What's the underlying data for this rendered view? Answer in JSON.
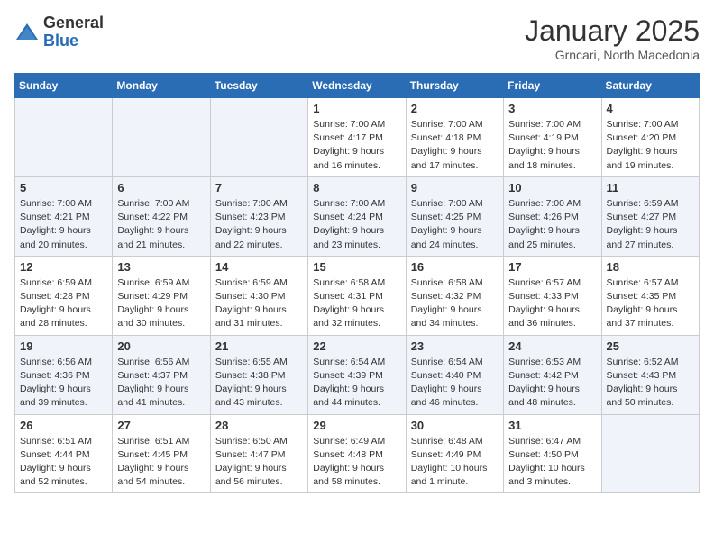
{
  "header": {
    "logo_general": "General",
    "logo_blue": "Blue",
    "month_title": "January 2025",
    "location": "Grncari, North Macedonia"
  },
  "weekdays": [
    "Sunday",
    "Monday",
    "Tuesday",
    "Wednesday",
    "Thursday",
    "Friday",
    "Saturday"
  ],
  "weeks": [
    [
      {
        "day": "",
        "empty": true
      },
      {
        "day": "",
        "empty": true
      },
      {
        "day": "",
        "empty": true
      },
      {
        "day": "1",
        "sunrise": "7:00 AM",
        "sunset": "4:17 PM",
        "daylight": "9 hours and 16 minutes."
      },
      {
        "day": "2",
        "sunrise": "7:00 AM",
        "sunset": "4:18 PM",
        "daylight": "9 hours and 17 minutes."
      },
      {
        "day": "3",
        "sunrise": "7:00 AM",
        "sunset": "4:19 PM",
        "daylight": "9 hours and 18 minutes."
      },
      {
        "day": "4",
        "sunrise": "7:00 AM",
        "sunset": "4:20 PM",
        "daylight": "9 hours and 19 minutes."
      }
    ],
    [
      {
        "day": "5",
        "sunrise": "7:00 AM",
        "sunset": "4:21 PM",
        "daylight": "9 hours and 20 minutes."
      },
      {
        "day": "6",
        "sunrise": "7:00 AM",
        "sunset": "4:22 PM",
        "daylight": "9 hours and 21 minutes."
      },
      {
        "day": "7",
        "sunrise": "7:00 AM",
        "sunset": "4:23 PM",
        "daylight": "9 hours and 22 minutes."
      },
      {
        "day": "8",
        "sunrise": "7:00 AM",
        "sunset": "4:24 PM",
        "daylight": "9 hours and 23 minutes."
      },
      {
        "day": "9",
        "sunrise": "7:00 AM",
        "sunset": "4:25 PM",
        "daylight": "9 hours and 24 minutes."
      },
      {
        "day": "10",
        "sunrise": "7:00 AM",
        "sunset": "4:26 PM",
        "daylight": "9 hours and 25 minutes."
      },
      {
        "day": "11",
        "sunrise": "6:59 AM",
        "sunset": "4:27 PM",
        "daylight": "9 hours and 27 minutes."
      }
    ],
    [
      {
        "day": "12",
        "sunrise": "6:59 AM",
        "sunset": "4:28 PM",
        "daylight": "9 hours and 28 minutes."
      },
      {
        "day": "13",
        "sunrise": "6:59 AM",
        "sunset": "4:29 PM",
        "daylight": "9 hours and 30 minutes."
      },
      {
        "day": "14",
        "sunrise": "6:59 AM",
        "sunset": "4:30 PM",
        "daylight": "9 hours and 31 minutes."
      },
      {
        "day": "15",
        "sunrise": "6:58 AM",
        "sunset": "4:31 PM",
        "daylight": "9 hours and 32 minutes."
      },
      {
        "day": "16",
        "sunrise": "6:58 AM",
        "sunset": "4:32 PM",
        "daylight": "9 hours and 34 minutes."
      },
      {
        "day": "17",
        "sunrise": "6:57 AM",
        "sunset": "4:33 PM",
        "daylight": "9 hours and 36 minutes."
      },
      {
        "day": "18",
        "sunrise": "6:57 AM",
        "sunset": "4:35 PM",
        "daylight": "9 hours and 37 minutes."
      }
    ],
    [
      {
        "day": "19",
        "sunrise": "6:56 AM",
        "sunset": "4:36 PM",
        "daylight": "9 hours and 39 minutes."
      },
      {
        "day": "20",
        "sunrise": "6:56 AM",
        "sunset": "4:37 PM",
        "daylight": "9 hours and 41 minutes."
      },
      {
        "day": "21",
        "sunrise": "6:55 AM",
        "sunset": "4:38 PM",
        "daylight": "9 hours and 43 minutes."
      },
      {
        "day": "22",
        "sunrise": "6:54 AM",
        "sunset": "4:39 PM",
        "daylight": "9 hours and 44 minutes."
      },
      {
        "day": "23",
        "sunrise": "6:54 AM",
        "sunset": "4:40 PM",
        "daylight": "9 hours and 46 minutes."
      },
      {
        "day": "24",
        "sunrise": "6:53 AM",
        "sunset": "4:42 PM",
        "daylight": "9 hours and 48 minutes."
      },
      {
        "day": "25",
        "sunrise": "6:52 AM",
        "sunset": "4:43 PM",
        "daylight": "9 hours and 50 minutes."
      }
    ],
    [
      {
        "day": "26",
        "sunrise": "6:51 AM",
        "sunset": "4:44 PM",
        "daylight": "9 hours and 52 minutes."
      },
      {
        "day": "27",
        "sunrise": "6:51 AM",
        "sunset": "4:45 PM",
        "daylight": "9 hours and 54 minutes."
      },
      {
        "day": "28",
        "sunrise": "6:50 AM",
        "sunset": "4:47 PM",
        "daylight": "9 hours and 56 minutes."
      },
      {
        "day": "29",
        "sunrise": "6:49 AM",
        "sunset": "4:48 PM",
        "daylight": "9 hours and 58 minutes."
      },
      {
        "day": "30",
        "sunrise": "6:48 AM",
        "sunset": "4:49 PM",
        "daylight": "10 hours and 1 minute."
      },
      {
        "day": "31",
        "sunrise": "6:47 AM",
        "sunset": "4:50 PM",
        "daylight": "10 hours and 3 minutes."
      },
      {
        "day": "",
        "empty": true
      }
    ]
  ],
  "labels": {
    "sunrise": "Sunrise: ",
    "sunset": "Sunset: ",
    "daylight": "Daylight: "
  }
}
